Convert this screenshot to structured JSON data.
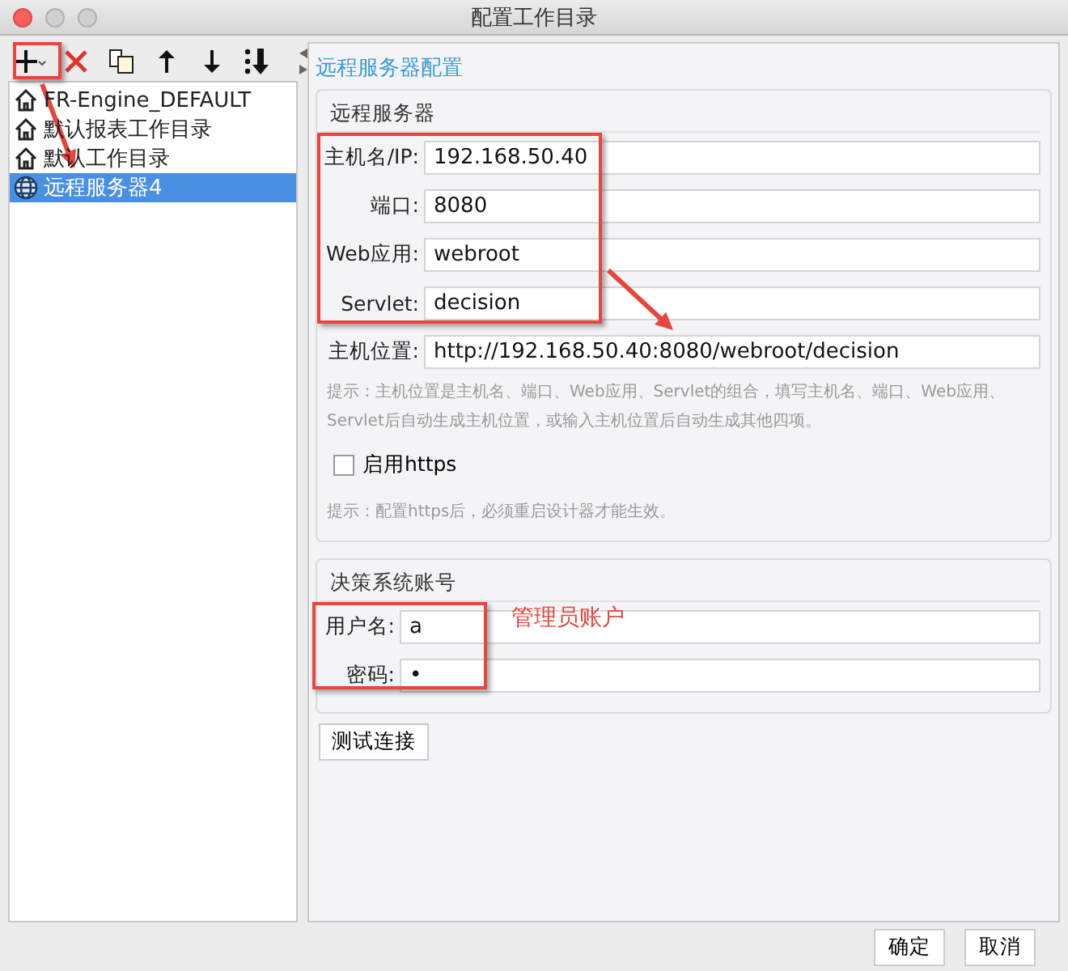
{
  "window": {
    "title": "配置工作目录"
  },
  "tree": [
    {
      "label": "FR-Engine_DEFAULT",
      "kind": "local",
      "selected": false
    },
    {
      "label": "默认报表工作目录",
      "kind": "local",
      "selected": false
    },
    {
      "label": "默认工作目录",
      "kind": "local",
      "selected": false
    },
    {
      "label": "远程服务器4",
      "kind": "remote",
      "selected": true
    }
  ],
  "panel_title": "远程服务器配置",
  "server_group": {
    "title": "远程服务器",
    "fields": [
      {
        "label": "主机名/IP:",
        "value": "192.168.50.40"
      },
      {
        "label": "端口:",
        "value": "8080"
      },
      {
        "label": "Web应用:",
        "value": "webroot"
      },
      {
        "label": "Servlet:",
        "value": "decision"
      },
      {
        "label": "主机位置:",
        "value": "http://192.168.50.40:8080/webroot/decision"
      }
    ],
    "hint": "提示：主机位置是主机名、端口、Web应用、Servlet的组合，填写主机名、端口、Web应用、Servlet后自动生成主机位置，或输入主机位置后自动生成其他四项。",
    "https": {
      "label": "启用https",
      "checked": false
    },
    "https_hint": "提示：配置https后，必须重启设计器才能生效。"
  },
  "account_group": {
    "title": "决策系统账号",
    "fields": [
      {
        "label": "用户名:",
        "value": "a"
      },
      {
        "label": "密码:",
        "value": "•"
      }
    ]
  },
  "annotation": "管理员账户",
  "test_button": "测试连接",
  "buttons": [
    "确定",
    "取消"
  ]
}
